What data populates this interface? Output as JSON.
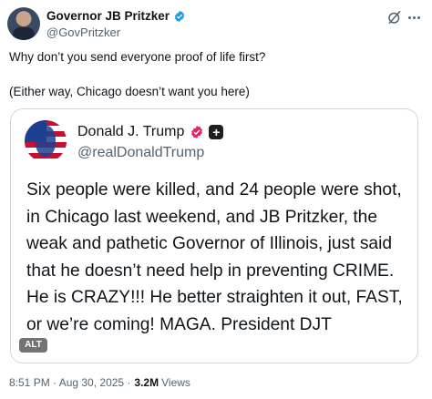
{
  "post": {
    "author_name": "Governor JB Pritzker",
    "author_handle": "@GovPritzker",
    "line1": "Why don’t you send everyone proof of life first?",
    "line2": "(Either way, Chicago doesn’t want you here)",
    "timestamp": "8:51 PM · Aug 30, 2025 ·",
    "views_count": "3.2M",
    "views_label": "Views"
  },
  "quoted": {
    "author_name": "Donald J. Trump",
    "author_handle": "@realDonaldTrump",
    "text": "Six people were killed, and 24 people were shot, in Chicago last weekend, and JB Pritzker, the weak and pathetic Governor of Illinois, just said that he doesn’t need help in preventing CRIME. He is CRAZY!!! He better straighten it out, FAST, or we’re coming! MAGA. President DJT",
    "alt_badge": "ALT"
  },
  "icons": {
    "verified": "verified-badge-icon",
    "grok": "grok-icon",
    "more": "more-icon",
    "verified_pink": "verified-pink-badge-icon",
    "government": "government-affiliation-icon"
  },
  "colors": {
    "verified_blue": "#1d9bf0",
    "verified_pink": "#e0245e",
    "secondary_text": "#536471",
    "border": "#cfd9de"
  }
}
